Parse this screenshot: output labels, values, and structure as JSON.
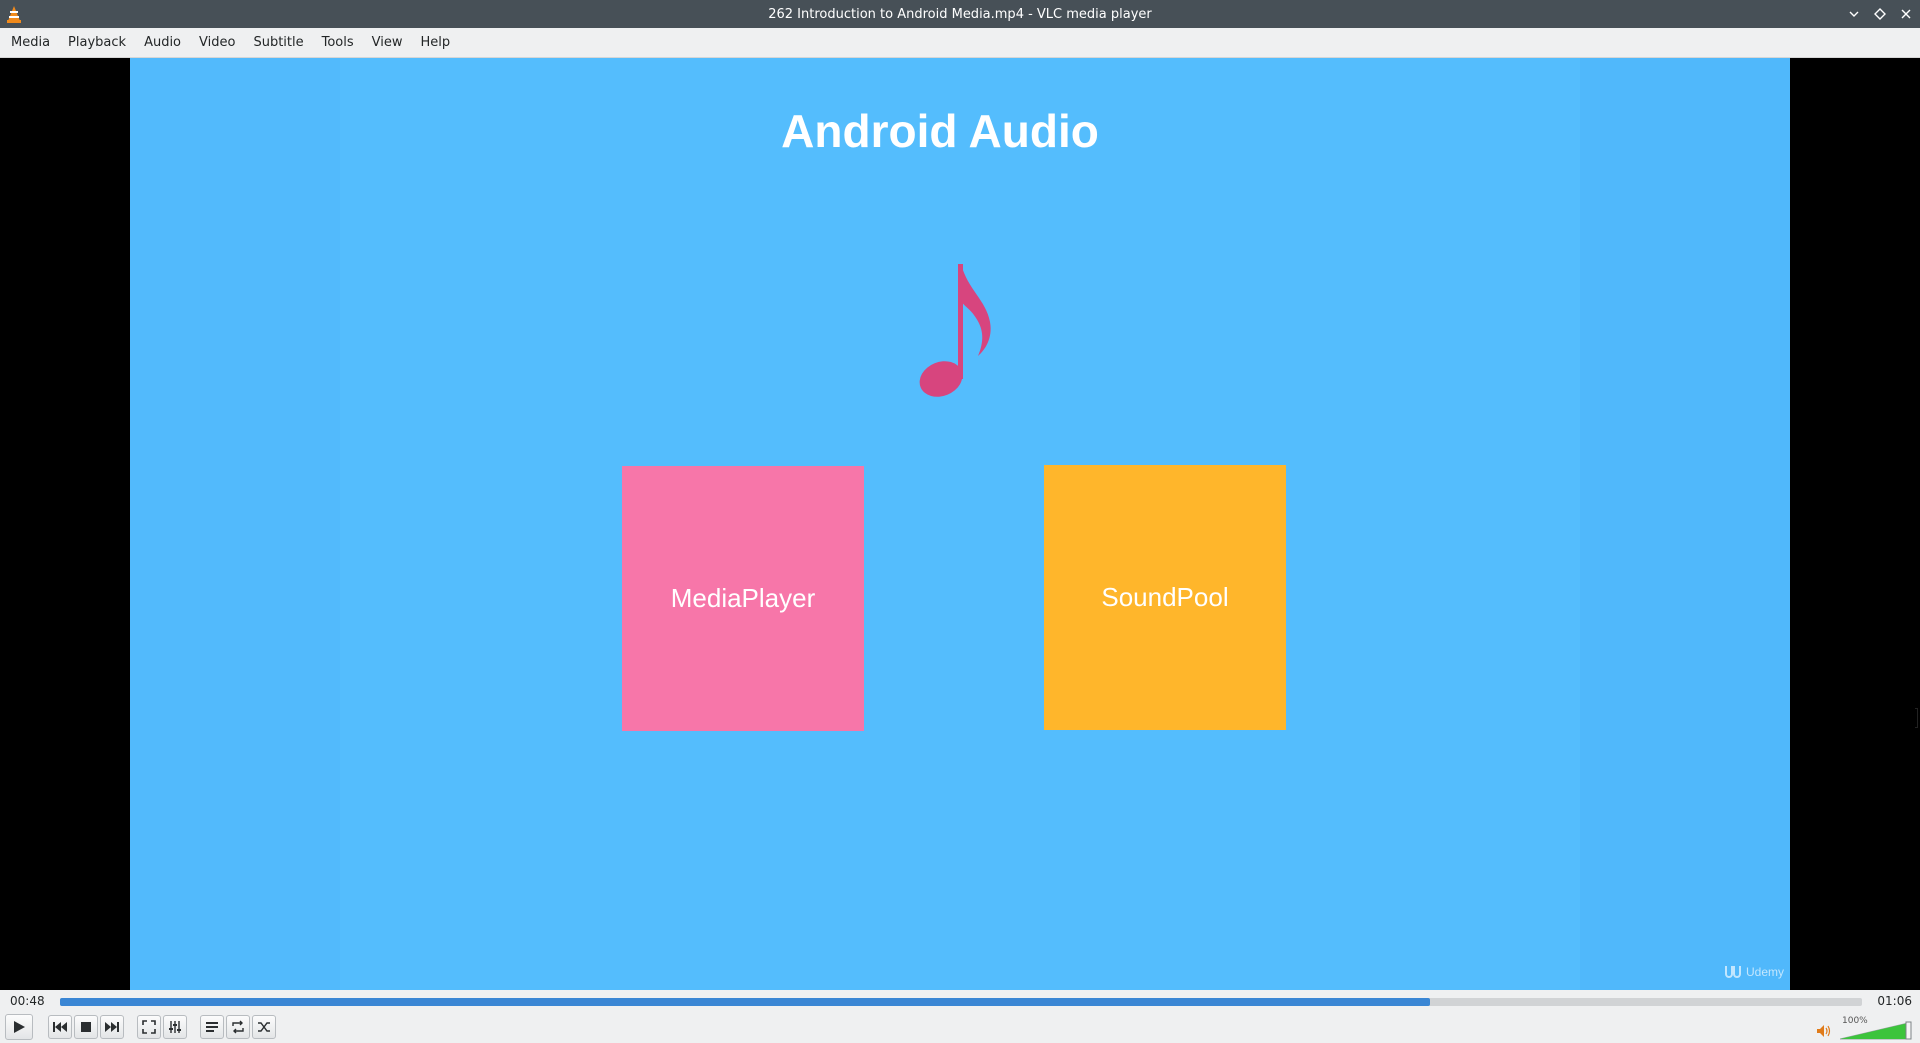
{
  "window": {
    "title": "262 Introduction to Android Media.mp4 - VLC media player"
  },
  "menubar": {
    "items": [
      "Media",
      "Playback",
      "Audio",
      "Video",
      "Subtitle",
      "Tools",
      "View",
      "Help"
    ]
  },
  "slide": {
    "title": "Android Audio",
    "note_icon": "music-note-icon",
    "boxes": [
      {
        "label": "MediaPlayer",
        "color": "#f776a9"
      },
      {
        "label": "SoundPool",
        "color": "#ffb62b"
      }
    ],
    "watermark": "Udemy",
    "background_color": "#54bdfd"
  },
  "playback": {
    "elapsed": "00:48",
    "total": "01:06",
    "progress_fraction": 0.76,
    "accent_color": "#3a86d4"
  },
  "controls": {
    "buttons": [
      "play-icon",
      "previous-icon",
      "stop-icon",
      "next-icon",
      "fullscreen-icon",
      "extended-settings-icon",
      "playlist-icon",
      "loop-icon",
      "shuffle-icon"
    ]
  },
  "volume": {
    "label": "100%",
    "level_fraction": 1.0,
    "color": "#3cc43c"
  }
}
